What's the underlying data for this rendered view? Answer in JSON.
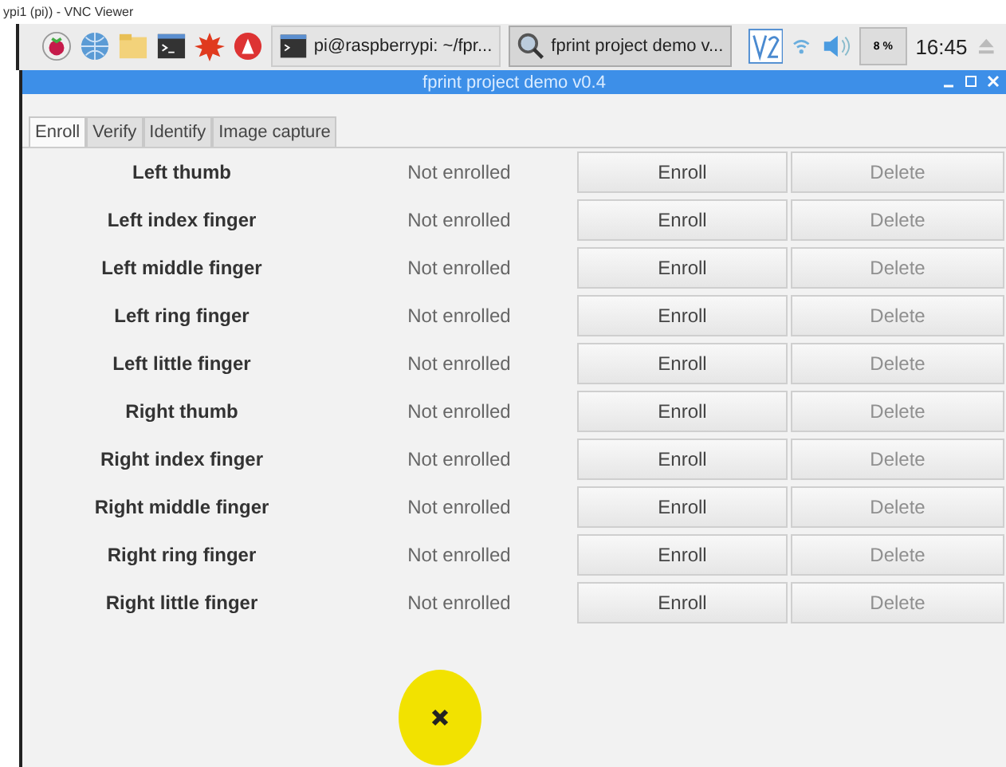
{
  "viewer_title": "ypi1 (pi)) - VNC Viewer",
  "taskbar": {
    "tasks": [
      {
        "label": "pi@raspberrypi: ~/fpr...",
        "kind": "terminal",
        "selected": false
      },
      {
        "label": "fprint project demo v...",
        "kind": "search",
        "selected": true
      }
    ],
    "battery": "8 %",
    "clock": "16:45"
  },
  "window": {
    "title": "fprint project demo v0.4"
  },
  "tabs": [
    {
      "label": "Enroll",
      "selected": true
    },
    {
      "label": "Verify",
      "selected": false
    },
    {
      "label": "Identify",
      "selected": false
    },
    {
      "label": "Image capture",
      "selected": false
    }
  ],
  "fingers": [
    {
      "name": "Left thumb",
      "status": "Not enrolled",
      "enroll": {
        "label": "Enroll",
        "disabled": false
      },
      "delete": {
        "label": "Delete",
        "disabled": true
      }
    },
    {
      "name": "Left index finger",
      "status": "Not enrolled",
      "enroll": {
        "label": "Enroll",
        "disabled": false
      },
      "delete": {
        "label": "Delete",
        "disabled": true
      }
    },
    {
      "name": "Left middle finger",
      "status": "Not enrolled",
      "enroll": {
        "label": "Enroll",
        "disabled": false
      },
      "delete": {
        "label": "Delete",
        "disabled": true
      }
    },
    {
      "name": "Left ring finger",
      "status": "Not enrolled",
      "enroll": {
        "label": "Enroll",
        "disabled": false
      },
      "delete": {
        "label": "Delete",
        "disabled": true
      }
    },
    {
      "name": "Left little finger",
      "status": "Not enrolled",
      "enroll": {
        "label": "Enroll",
        "disabled": false
      },
      "delete": {
        "label": "Delete",
        "disabled": true
      }
    },
    {
      "name": "Right thumb",
      "status": "Not enrolled",
      "enroll": {
        "label": "Enroll",
        "disabled": false
      },
      "delete": {
        "label": "Delete",
        "disabled": true
      }
    },
    {
      "name": "Right index finger",
      "status": "Not enrolled",
      "enroll": {
        "label": "Enroll",
        "disabled": false
      },
      "delete": {
        "label": "Delete",
        "disabled": true
      }
    },
    {
      "name": "Right middle finger",
      "status": "Not enrolled",
      "enroll": {
        "label": "Enroll",
        "disabled": false
      },
      "delete": {
        "label": "Delete",
        "disabled": true
      }
    },
    {
      "name": "Right ring finger",
      "status": "Not enrolled",
      "enroll": {
        "label": "Enroll",
        "disabled": false
      },
      "delete": {
        "label": "Delete",
        "disabled": true
      }
    },
    {
      "name": "Right little finger",
      "status": "Not enrolled",
      "enroll": {
        "label": "Enroll",
        "disabled": false
      },
      "delete": {
        "label": "Delete",
        "disabled": true
      }
    }
  ]
}
